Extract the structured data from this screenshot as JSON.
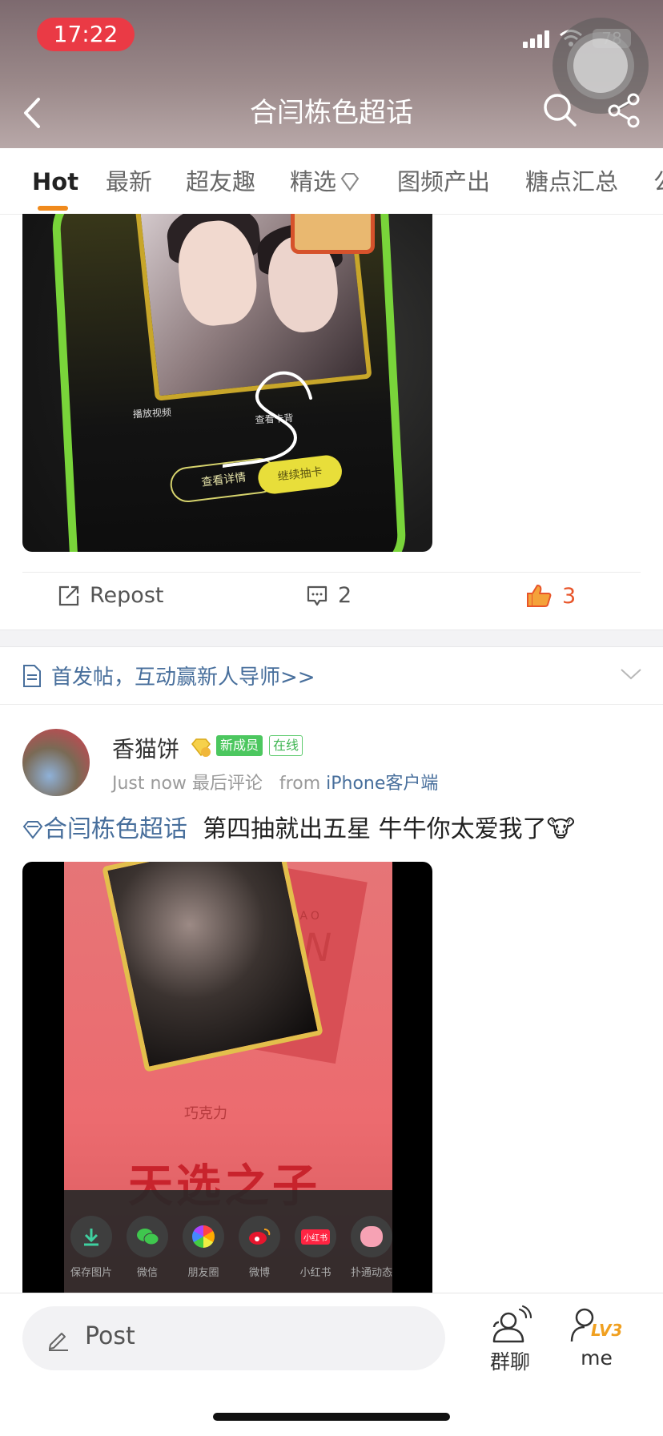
{
  "status_bar": {
    "time": "17:22",
    "battery": "78"
  },
  "header": {
    "title": "合闫栋色超话"
  },
  "tabs": [
    {
      "label": "Hot"
    },
    {
      "label": "最新"
    },
    {
      "label": "超友趣"
    },
    {
      "label": "精选"
    },
    {
      "label": "图频产出"
    },
    {
      "label": "糖点汇总"
    },
    {
      "label": "公"
    }
  ],
  "post1": {
    "image_texts": {
      "play_video": "播放视频",
      "view_back": "查看卡背",
      "view_details": "查看详情",
      "continue_draw": "继续抽卡"
    },
    "actions": {
      "repost_label": "Repost",
      "comment_count": "2",
      "like_count": "3"
    }
  },
  "notice": {
    "text": "首发帖，互动赢新人导师>>"
  },
  "post2": {
    "username": "香猫饼",
    "badge_new": "新成员",
    "badge_online": "在线",
    "time": "Just now",
    "last_comment": "最后评论",
    "from_prefix": "from",
    "client": "iPhone客户端",
    "topic": "合闫栋色超话",
    "text": "第四抽就出五星 牛牛你太爱我了🐮",
    "image_texts": {
      "deco": "YAN",
      "deco_small": "HAO",
      "brand": "巧克力",
      "big_title": "天选之子",
      "share_items": [
        "保存图片",
        "微信",
        "朋友圈",
        "微博",
        "小红书",
        "扑通动态"
      ],
      "xiaohongshu_icon_text": "小红书"
    }
  },
  "bottom_bar": {
    "post_label": "Post",
    "group_chat_label": "群聊",
    "me_label": "me",
    "level": "LV3"
  },
  "colors": {
    "accent_orange": "#f08a1c",
    "link_blue": "#486f9c",
    "like_red": "#e8552a",
    "time_pill": "#ea3a45"
  }
}
